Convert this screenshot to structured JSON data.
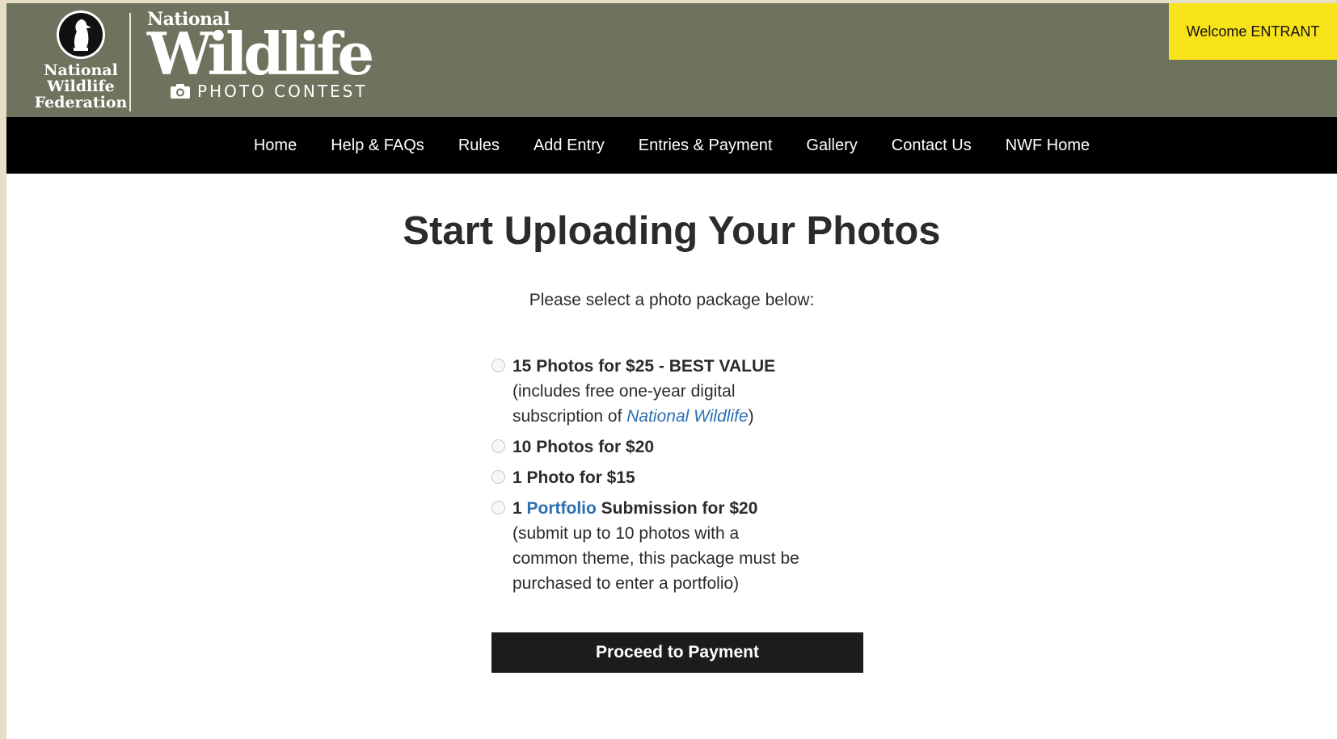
{
  "header": {
    "org_logo_text": "National Wildlife Federation",
    "contest_national": "National",
    "contest_wildlife": "Wildlife",
    "contest_subtitle": "PHOTO CONTEST",
    "welcome": "Welcome ENTRANT",
    "colors": {
      "header_bg": "#6d735c",
      "welcome_bg": "#f8e21a",
      "nav_bg": "#000000"
    }
  },
  "nav": {
    "items": [
      {
        "label": "Home"
      },
      {
        "label": "Help & FAQs"
      },
      {
        "label": "Rules"
      },
      {
        "label": "Add Entry"
      },
      {
        "label": "Entries & Payment"
      },
      {
        "label": "Gallery"
      },
      {
        "label": "Contact Us"
      },
      {
        "label": "NWF Home"
      }
    ]
  },
  "main": {
    "title": "Start Uploading Your Photos",
    "subtitle": "Please select a photo package below:",
    "options": [
      {
        "bold": "15 Photos for $25 - BEST VALUE",
        "desc_before": "(includes free one-year digital subscription of ",
        "desc_link": "National Wildlife",
        "desc_after": ")"
      },
      {
        "bold": "10 Photos for $20"
      },
      {
        "bold": "1 Photo for $15"
      },
      {
        "bold_prefix": "1 ",
        "bold_link": "Portfolio",
        "bold_suffix": " Submission for $20",
        "desc": "(submit up to 10 photos with a common theme, this package must be purchased to enter a portfolio)"
      }
    ],
    "proceed_button": "Proceed to Payment"
  }
}
